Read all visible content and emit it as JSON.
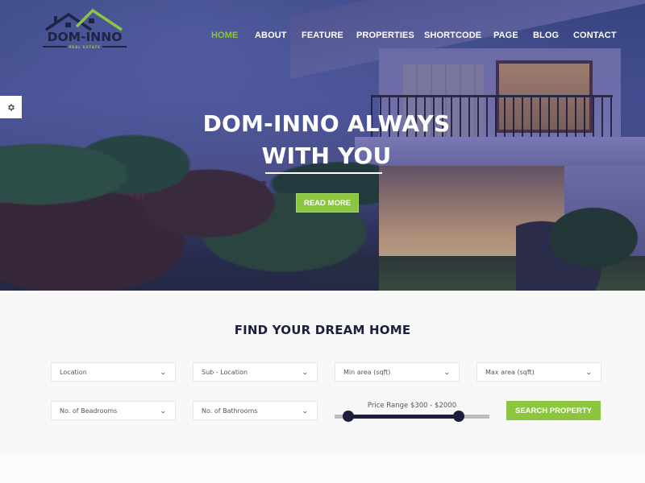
{
  "brand": {
    "name": "DOM-INNO",
    "tagline": "REAL ESTATE",
    "colors": {
      "accent": "#8cc63f",
      "dark": "#1c1f3b",
      "logo_dark": "#1f2346"
    }
  },
  "nav": {
    "items": [
      {
        "label": "HOME",
        "active": true
      },
      {
        "label": "ABOUT",
        "active": false
      },
      {
        "label": "FEATURE",
        "active": false
      },
      {
        "label": "PROPERTIES",
        "active": false
      },
      {
        "label": "SHORTCODE",
        "active": false
      },
      {
        "label": "PAGE",
        "active": false
      },
      {
        "label": "BLOG",
        "active": false
      },
      {
        "label": "CONTACT",
        "active": false
      }
    ]
  },
  "settings_tab": {
    "icon": "gear-icon"
  },
  "hero": {
    "title_line1": "DOM-INNO ALWAYS",
    "title_line2": "WITH YOU",
    "cta_label": "READ MORE"
  },
  "search": {
    "title": "FIND YOUR DREAM HOME",
    "fields": [
      {
        "label": "Location",
        "icon": "chevron-down-icon"
      },
      {
        "label": "Sub - Location",
        "icon": "chevron-down-icon"
      },
      {
        "label": "Min area (sqft)",
        "icon": "chevron-down-icon"
      },
      {
        "label": "Max area (sqft)",
        "icon": "chevron-down-icon"
      },
      {
        "label": "No. of Beadrooms",
        "icon": "chevron-down-icon"
      },
      {
        "label": "No. of Bathrooms",
        "icon": "chevron-down-icon"
      }
    ],
    "price_range": {
      "label": "Price Range $300 - $2000",
      "min_value": 300,
      "max_value": 2000,
      "low_fraction": 0.09,
      "high_fraction": 0.8
    },
    "submit_label": "SEARCH PROPERTY"
  }
}
